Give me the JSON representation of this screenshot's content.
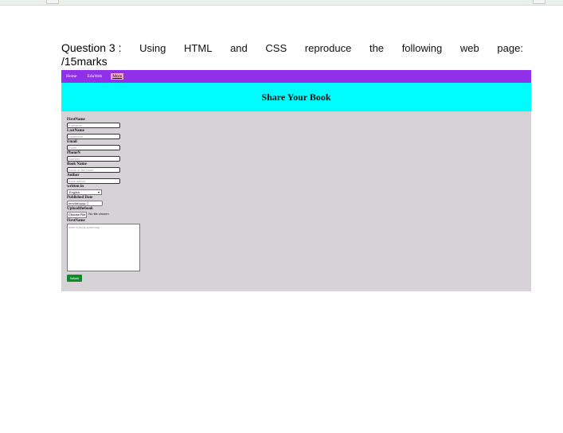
{
  "question": {
    "number_label": "Question 3 :",
    "words": [
      "Using",
      "HTML",
      "and",
      "CSS",
      "reproduce",
      "the",
      "following",
      "web",
      "page:"
    ],
    "marks": "/15marks"
  },
  "page": {
    "nav": [
      "Home",
      "EduWeb",
      "More"
    ],
    "hero_title": "Share Your Book",
    "form": {
      "first_name_label": "FirstName",
      "first_name_placeholder": "FullName",
      "last_name_label": "LastName",
      "last_name_placeholder": "LastName",
      "email_label": "Email",
      "email_placeholder": "Email",
      "phone_label": "PhoneN",
      "phone_placeholder": "Number",
      "book_name_label": "Book Name",
      "book_name_placeholder": "name of the book",
      "author_label": "Author",
      "author_placeholder": "book author",
      "written_in_label": "written in",
      "written_in_value": "English",
      "published_label": "Published Date",
      "published_value": "mm/dd/yyyy",
      "upload_label": "Uploadthebook",
      "upload_button": "Choose File",
      "upload_status": "No file chosen",
      "summary_label": "FirstName",
      "summary_placeholder": "write a book summary...",
      "submit_label": "Submit"
    }
  }
}
